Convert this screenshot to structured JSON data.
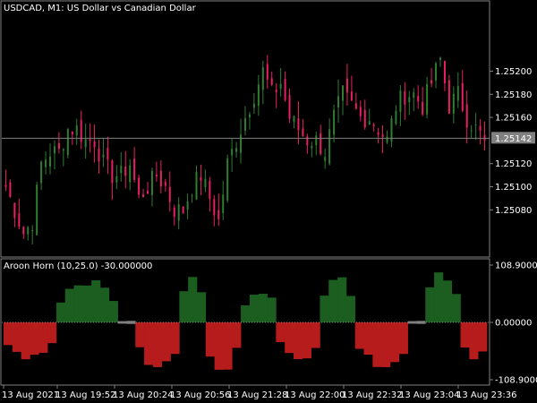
{
  "chart_data": [
    {
      "type": "candlestick",
      "title": "USDCAD, M1:  US Dollar vs Canadian Dollar",
      "ylim": [
        1.2504,
        1.2526
      ],
      "y_ticks": [
        "1.25200",
        "1.25180",
        "1.25160",
        "1.25120",
        "1.25100",
        "1.25080"
      ],
      "current_price": "1.25142",
      "colors": {
        "bull": "#2e7d32",
        "bear": "#e91e63",
        "neutral": "#f5f5f5",
        "price_line": "#808080",
        "price_label_bg": "#808080"
      },
      "close_path": [
        1.251,
        1.2508,
        1.2506,
        1.2507,
        1.2512,
        1.2513,
        1.2513,
        1.2515,
        1.2515,
        1.2514,
        1.2514,
        1.2512,
        1.2511,
        1.2511,
        1.2512,
        1.2509,
        1.251,
        1.2511,
        1.251,
        1.2508,
        1.2508,
        1.251,
        1.2511,
        1.2509,
        1.2507,
        1.2512,
        1.2514,
        1.2516,
        1.2518,
        1.252,
        1.2518,
        1.2519,
        1.2516,
        1.2515,
        1.2514,
        1.2514,
        1.2513,
        1.2516,
        1.2518,
        1.2517,
        1.2516,
        1.2516,
        1.2515,
        1.2514,
        1.2517,
        1.2518,
        1.2518,
        1.2517,
        1.2519,
        1.2521,
        1.2517,
        1.2518,
        1.2516,
        1.2515,
        1.2514
      ]
    },
    {
      "type": "bar",
      "title": "Aroon Horn (10,25.0) -30.000000",
      "ylim": [
        -108.9,
        108.9
      ],
      "y_ticks": [
        "108.90000",
        "0.00000",
        "-108.90000"
      ],
      "colors": {
        "positive": "#1b5e20",
        "negative": "#b71c1c",
        "flat": "#808080"
      },
      "x_tick_labels": [
        "13 Aug 2021",
        "13 Aug 19:52",
        "13 Aug 20:24",
        "13 Aug 20:56",
        "13 Aug 21:28",
        "13 Aug 22:00",
        "13 Aug 22:32",
        "13 Aug 23:04",
        "13 Aug 23:36"
      ],
      "segments": [
        {
          "from": 0,
          "to": 6,
          "sign": "neg",
          "peak": 70
        },
        {
          "from": 6,
          "to": 13,
          "sign": "pos",
          "peak": 80
        },
        {
          "from": 13,
          "to": 15,
          "sign": "flat",
          "peak": 15
        },
        {
          "from": 15,
          "to": 20,
          "sign": "neg",
          "peak": 85
        },
        {
          "from": 20,
          "to": 23,
          "sign": "pos",
          "peak": 95
        },
        {
          "from": 23,
          "to": 27,
          "sign": "neg",
          "peak": 90
        },
        {
          "from": 27,
          "to": 31,
          "sign": "pos",
          "peak": 60
        },
        {
          "from": 31,
          "to": 36,
          "sign": "neg",
          "peak": 75
        },
        {
          "from": 36,
          "to": 40,
          "sign": "pos",
          "peak": 90
        },
        {
          "from": 40,
          "to": 46,
          "sign": "neg",
          "peak": 85
        },
        {
          "from": 46,
          "to": 48,
          "sign": "flat",
          "peak": 15
        },
        {
          "from": 48,
          "to": 52,
          "sign": "pos",
          "peak": 95
        },
        {
          "from": 52,
          "to": 55,
          "sign": "neg",
          "peak": 70
        }
      ]
    }
  ]
}
